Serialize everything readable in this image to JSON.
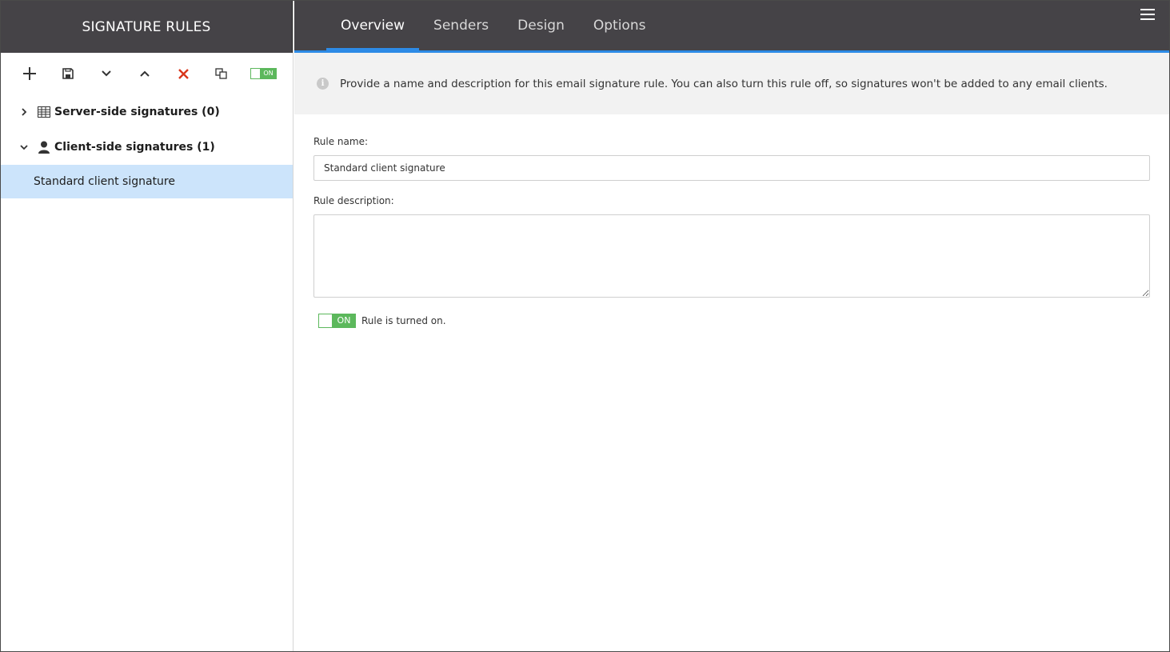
{
  "sidebar": {
    "title": "SIGNATURE RULES",
    "toolbar": {
      "toggle_label": "ON"
    },
    "groups": [
      {
        "label": "Server-side signatures (0)",
        "icon": "server-icon",
        "expanded": false
      },
      {
        "label": "Client-side signatures (1)",
        "icon": "user-icon",
        "expanded": true
      }
    ],
    "items": [
      {
        "label": "Standard client signature",
        "selected": true
      }
    ]
  },
  "tabs": [
    {
      "label": "Overview",
      "active": true
    },
    {
      "label": "Senders",
      "active": false
    },
    {
      "label": "Design",
      "active": false
    },
    {
      "label": "Options",
      "active": false
    }
  ],
  "info": {
    "text": "Provide a name and description for this email signature rule. You can also turn this rule off, so signatures won't be added to any email clients."
  },
  "form": {
    "rule_name_label": "Rule name:",
    "rule_name_value": "Standard client signature",
    "rule_description_label": "Rule description:",
    "rule_description_value": "",
    "toggle_label": "ON",
    "toggle_status": "Rule is turned on."
  },
  "colors": {
    "header_bg": "#454347",
    "accent": "#2d8be6",
    "toggle_green": "#5cb85c",
    "selected_bg": "#cce4fb",
    "delete_red": "#d9361b"
  }
}
